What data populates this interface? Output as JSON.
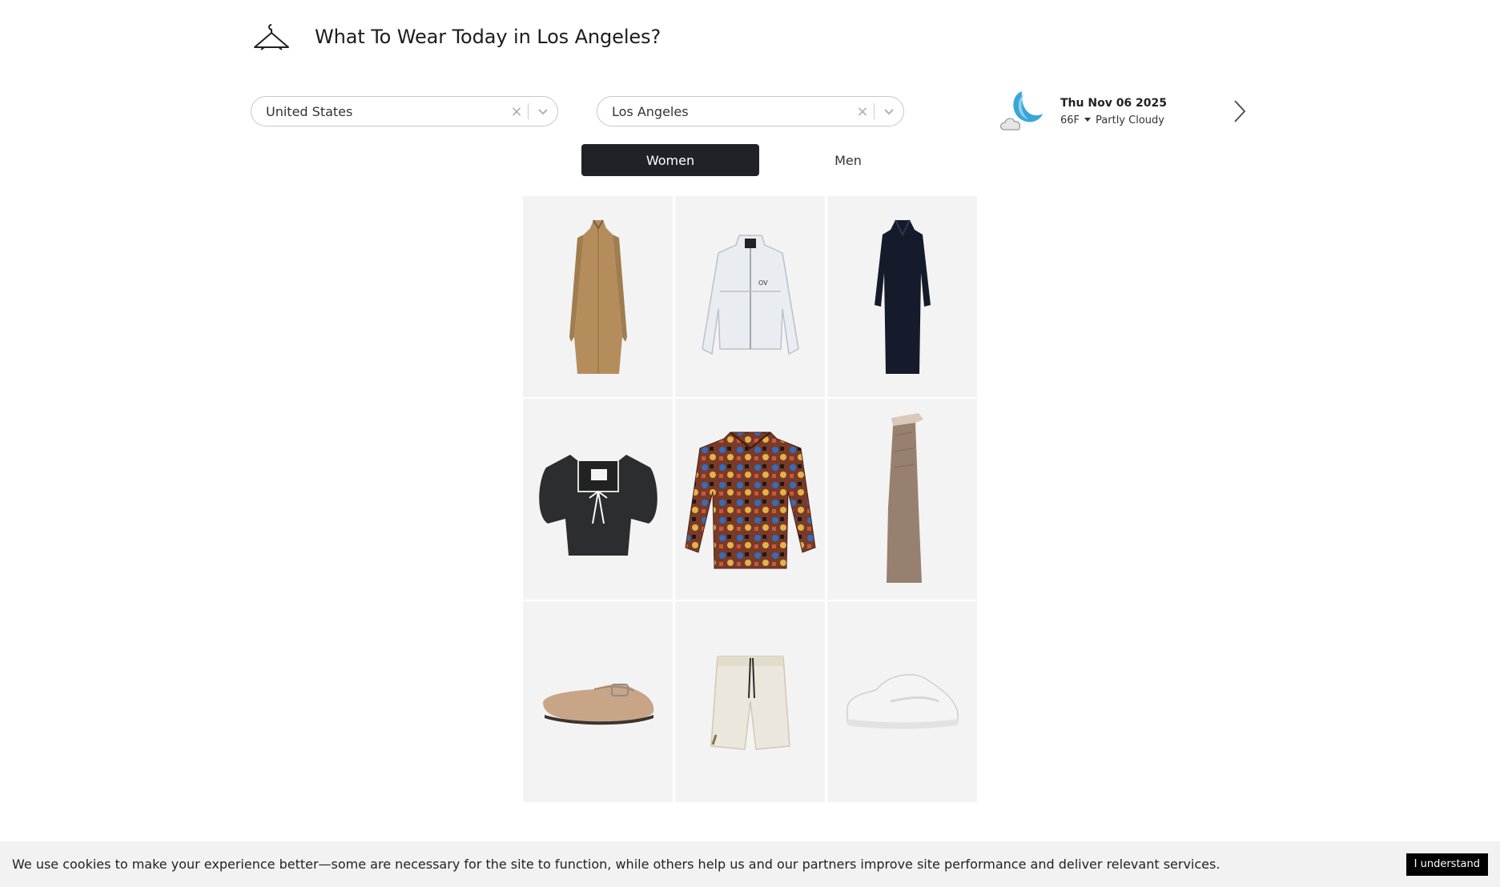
{
  "header": {
    "logo_icon": "hanger-icon",
    "title": "What To Wear Today in Los Angeles?"
  },
  "filters": {
    "country": {
      "value": "United States",
      "clear_icon": "close-icon",
      "dropdown_icon": "chevron-down-icon"
    },
    "city": {
      "value": "Los Angeles",
      "clear_icon": "close-icon",
      "dropdown_icon": "chevron-down-icon"
    }
  },
  "weather": {
    "icon": "moon-cloud-icon",
    "date": "Thu Nov 06 2025",
    "temperature": "66F",
    "condition": "Partly Cloudy",
    "next_icon": "chevron-right-icon"
  },
  "tabs": [
    {
      "label": "Women",
      "active": true
    },
    {
      "label": "Men",
      "active": false
    }
  ],
  "outfit_items": [
    {
      "name": "tan-trench-coat"
    },
    {
      "name": "white-windbreaker-jacket"
    },
    {
      "name": "navy-shirt-dress"
    },
    {
      "name": "black-puff-sleeve-top"
    },
    {
      "name": "printed-silk-shirt"
    },
    {
      "name": "taupe-maxi-skirt"
    },
    {
      "name": "suede-driving-loafer"
    },
    {
      "name": "cream-drawstring-shorts"
    },
    {
      "name": "white-sneaker"
    }
  ],
  "cookie_banner": {
    "message": "We use cookies to make your experience better—some are necessary for the site to function, while others help us and our partners improve site performance and deliver relevant services.",
    "button_label": "I understand"
  },
  "colors": {
    "active_tab": "#1f2327",
    "tile_background": "#f3f3f3",
    "cookie_bar": "#f2f2f2",
    "weather_moon": "#3aa6d8"
  }
}
